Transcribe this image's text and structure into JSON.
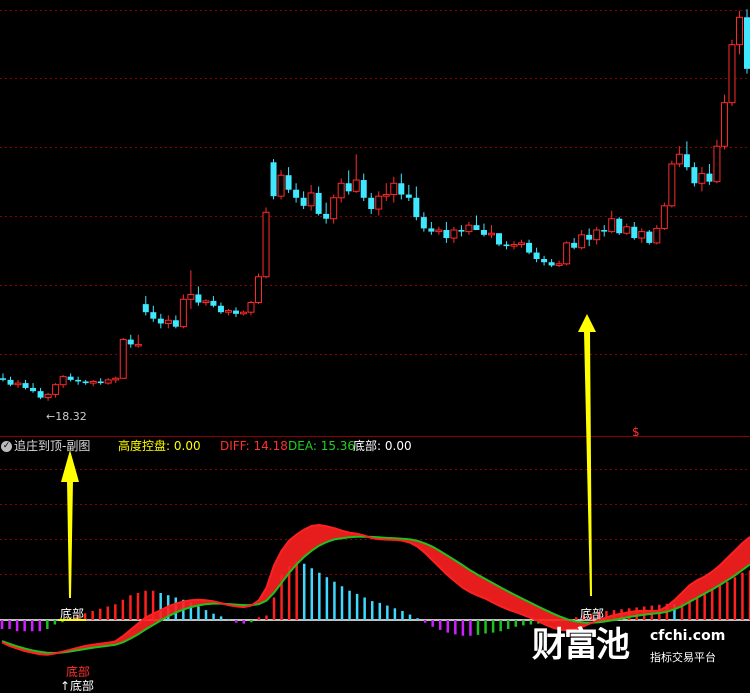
{
  "header": {
    "indicator_name": "追庄到顶-副图",
    "items": [
      {
        "label": "高度控盘:",
        "value": "0.00",
        "color": "#ffff00"
      },
      {
        "label": "DIFF:",
        "value": "14.18",
        "color": "#ff3030"
      },
      {
        "label": "DEA:",
        "value": "15.36",
        "color": "#20d020"
      },
      {
        "label": "底部:",
        "value": "0.00",
        "color": "#ffffff"
      }
    ]
  },
  "annotations": {
    "low_price_label": "←18.32",
    "signal_mark": "$",
    "bottom_label_1": "底部",
    "bottom_label_2": "底部",
    "bottom_label_3": "↑底部",
    "bottom_label_3_overlay": "底部"
  },
  "watermark": {
    "brand": "财富池",
    "site": "cfchi.com",
    "tagline": "指标交易平台"
  },
  "colors": {
    "up": "#ff2a2a",
    "down": "#40e8ff",
    "grid": "#8b0000",
    "diff": "#ff2020",
    "dea": "#20c020",
    "arrow": "#ffff00",
    "hist_pos_red": "#ff2020",
    "hist_pos_cyan": "#40d8ff",
    "hist_neg_magenta": "#d020ff",
    "hist_neg_green": "#20c020"
  },
  "chart_data": [
    {
      "type": "candlestick",
      "title": "",
      "ylim": [
        16,
        42
      ],
      "grid": true,
      "candles": [
        [
          18.9,
          19.2,
          18.7,
          18.8
        ],
        [
          18.8,
          19.0,
          18.4,
          18.5
        ],
        [
          18.5,
          18.8,
          18.3,
          18.6
        ],
        [
          18.6,
          18.8,
          18.2,
          18.3
        ],
        [
          18.3,
          18.6,
          18.0,
          18.1
        ],
        [
          18.1,
          18.3,
          17.6,
          17.7
        ],
        [
          17.7,
          18.0,
          17.5,
          17.9
        ],
        [
          17.9,
          18.6,
          17.7,
          18.5
        ],
        [
          18.5,
          19.1,
          18.3,
          19.0
        ],
        [
          19.0,
          19.2,
          18.7,
          18.8
        ],
        [
          18.8,
          19.0,
          18.5,
          18.7
        ],
        [
          18.7,
          18.8,
          18.5,
          18.6
        ],
        [
          18.6,
          18.8,
          18.4,
          18.7
        ],
        [
          18.7,
          18.9,
          18.5,
          18.6
        ],
        [
          18.6,
          18.9,
          18.5,
          18.8
        ],
        [
          18.8,
          19.0,
          18.6,
          18.9
        ],
        [
          18.9,
          21.4,
          18.9,
          21.3
        ],
        [
          21.3,
          21.6,
          20.8,
          21.0
        ],
        [
          21.0,
          21.6,
          20.8,
          21.0
        ],
        [
          23.5,
          24.0,
          22.8,
          23.0
        ],
        [
          23.0,
          23.4,
          22.4,
          22.6
        ],
        [
          22.6,
          22.9,
          22.0,
          22.3
        ],
        [
          22.3,
          22.8,
          22.0,
          22.5
        ],
        [
          22.5,
          22.8,
          22.0,
          22.1
        ],
        [
          22.1,
          24.1,
          22.0,
          23.8
        ],
        [
          23.8,
          25.6,
          23.2,
          24.1
        ],
        [
          24.1,
          24.6,
          23.4,
          23.6
        ],
        [
          23.6,
          23.8,
          23.4,
          23.7
        ],
        [
          23.7,
          24.0,
          23.3,
          23.4
        ],
        [
          23.4,
          23.6,
          22.9,
          23.0
        ],
        [
          23.0,
          23.2,
          22.8,
          23.1
        ],
        [
          23.1,
          23.3,
          22.7,
          22.9
        ],
        [
          22.9,
          23.1,
          22.8,
          23.0
        ],
        [
          23.0,
          23.7,
          22.8,
          23.6
        ],
        [
          23.6,
          25.4,
          23.5,
          25.2
        ],
        [
          25.2,
          29.5,
          25.1,
          29.2
        ],
        [
          32.3,
          32.5,
          30.0,
          30.2
        ],
        [
          30.2,
          31.8,
          30.0,
          31.5
        ],
        [
          31.5,
          32.0,
          30.4,
          30.6
        ],
        [
          30.6,
          31.0,
          29.8,
          30.1
        ],
        [
          30.1,
          30.5,
          29.4,
          29.6
        ],
        [
          29.6,
          30.9,
          29.3,
          30.4
        ],
        [
          30.4,
          30.8,
          29.0,
          29.1
        ],
        [
          29.1,
          29.8,
          28.5,
          28.8
        ],
        [
          28.8,
          30.3,
          28.5,
          30.1
        ],
        [
          30.1,
          31.3,
          29.8,
          31.0
        ],
        [
          31.0,
          31.8,
          30.3,
          30.5
        ],
        [
          30.5,
          32.8,
          30.4,
          31.2
        ],
        [
          31.2,
          31.6,
          29.9,
          30.1
        ],
        [
          30.1,
          30.4,
          29.1,
          29.4
        ],
        [
          29.4,
          30.5,
          29.0,
          30.2
        ],
        [
          30.2,
          31.0,
          29.9,
          30.3
        ],
        [
          30.3,
          31.4,
          29.8,
          31.0
        ],
        [
          31.0,
          31.6,
          30.0,
          30.3
        ],
        [
          30.3,
          30.9,
          29.9,
          30.1
        ],
        [
          30.1,
          30.8,
          28.7,
          28.9
        ],
        [
          28.9,
          29.2,
          28.0,
          28.2
        ],
        [
          28.2,
          28.6,
          27.8,
          28.0
        ],
        [
          28.0,
          28.3,
          27.8,
          28.1
        ],
        [
          28.1,
          28.6,
          27.3,
          27.6
        ],
        [
          27.6,
          28.3,
          27.3,
          28.1
        ],
        [
          28.1,
          28.4,
          27.7,
          28.0
        ],
        [
          28.0,
          28.6,
          27.8,
          28.4
        ],
        [
          28.4,
          29.0,
          28.2,
          28.1
        ],
        [
          28.1,
          28.5,
          27.7,
          27.8
        ],
        [
          27.8,
          28.4,
          27.6,
          27.9
        ],
        [
          27.9,
          27.9,
          27.1,
          27.2
        ],
        [
          27.2,
          27.4,
          26.9,
          27.1
        ],
        [
          27.1,
          27.4,
          26.9,
          27.2
        ],
        [
          27.2,
          27.5,
          27.0,
          27.3
        ],
        [
          27.3,
          27.5,
          26.6,
          26.7
        ],
        [
          26.7,
          27.0,
          26.1,
          26.3
        ],
        [
          26.3,
          26.5,
          25.9,
          26.1
        ],
        [
          26.1,
          26.3,
          25.8,
          25.9
        ],
        [
          25.9,
          26.2,
          25.8,
          26.0
        ],
        [
          26.0,
          27.4,
          25.9,
          27.3
        ],
        [
          27.3,
          27.6,
          26.9,
          27.0
        ],
        [
          27.0,
          28.1,
          26.9,
          27.8
        ],
        [
          27.8,
          28.2,
          27.1,
          27.5
        ],
        [
          27.5,
          28.3,
          27.2,
          28.1
        ],
        [
          28.1,
          28.4,
          27.7,
          28.0
        ],
        [
          28.0,
          29.3,
          27.9,
          28.8
        ],
        [
          28.8,
          28.9,
          27.8,
          27.9
        ],
        [
          27.9,
          28.5,
          27.8,
          28.3
        ],
        [
          28.3,
          28.6,
          27.5,
          27.6
        ],
        [
          27.6,
          28.2,
          27.3,
          28.0
        ],
        [
          28.0,
          28.1,
          27.2,
          27.3
        ],
        [
          27.3,
          28.4,
          27.2,
          28.2
        ],
        [
          28.2,
          29.8,
          28.1,
          29.6
        ],
        [
          29.6,
          32.4,
          29.5,
          32.2
        ],
        [
          32.2,
          33.3,
          32.0,
          32.8
        ],
        [
          32.8,
          33.6,
          31.8,
          32.0
        ],
        [
          32.0,
          32.3,
          30.8,
          31.0
        ],
        [
          31.0,
          32.0,
          30.5,
          31.6
        ],
        [
          31.6,
          32.2,
          30.9,
          31.1
        ],
        [
          31.1,
          33.7,
          31.0,
          33.3
        ],
        [
          33.3,
          36.5,
          33.1,
          36.0
        ],
        [
          36.0,
          39.9,
          35.8,
          39.6
        ],
        [
          39.6,
          41.7,
          39.0,
          41.3
        ],
        [
          41.3,
          41.8,
          37.8,
          38.1
        ]
      ],
      "annotation": {
        "label": "←18.32",
        "value": 18.32
      }
    },
    {
      "type": "line",
      "title": "追庄到顶-副图",
      "ylim": [
        -15,
        50
      ],
      "series": [
        {
          "name": "DIFF",
          "values": [
            -9.0,
            -10.5,
            -11.5,
            -12.5,
            -13.2,
            -13.8,
            -14.0,
            -13.5,
            -12.8,
            -12.0,
            -11.2,
            -10.5,
            -10.0,
            -9.6,
            -9.2,
            -8.6,
            -6.5,
            -4.0,
            -1.5,
            1.0,
            2.5,
            4.0,
            5.5,
            6.6,
            7.4,
            8.0,
            8.2,
            8.0,
            7.5,
            6.8,
            6.0,
            5.5,
            5.2,
            5.8,
            8.0,
            13.0,
            22.0,
            28.0,
            32.0,
            34.5,
            36.5,
            38.0,
            38.3,
            37.8,
            37.0,
            36.0,
            35.2,
            34.8,
            34.0,
            33.0,
            32.6,
            32.4,
            32.3,
            32.0,
            31.2,
            29.5,
            27.0,
            24.0,
            21.0,
            18.0,
            15.5,
            13.0,
            11.2,
            9.8,
            8.6,
            7.0,
            5.5,
            4.2,
            3.2,
            2.0,
            0.8,
            -0.5,
            -2.0,
            -3.2,
            -4.0,
            -4.2,
            -3.5,
            -2.5,
            -1.2,
            0.0,
            1.0,
            2.0,
            2.6,
            3.2,
            3.6,
            3.8,
            3.6,
            3.8,
            5.5,
            8.0,
            11.0,
            14.0,
            16.0,
            17.5,
            19.5,
            22.0,
            25.0,
            28.0,
            31.0,
            33.5
          ]
        },
        {
          "name": "DEA",
          "values": [
            -8.5,
            -9.6,
            -10.6,
            -11.5,
            -12.2,
            -12.8,
            -13.2,
            -13.3,
            -13.1,
            -12.7,
            -12.2,
            -11.7,
            -11.2,
            -10.8,
            -10.4,
            -10.0,
            -9.0,
            -7.5,
            -5.8,
            -3.8,
            -2.0,
            -0.2,
            1.5,
            3.0,
            4.2,
            5.2,
            5.9,
            6.4,
            6.6,
            6.6,
            6.4,
            6.2,
            6.0,
            6.0,
            6.4,
            7.8,
            11.0,
            15.0,
            19.0,
            22.5,
            25.5,
            28.0,
            30.0,
            31.5,
            32.5,
            33.0,
            33.4,
            33.6,
            33.6,
            33.5,
            33.3,
            33.1,
            33.0,
            32.8,
            32.5,
            31.9,
            30.9,
            29.5,
            27.8,
            25.9,
            24.0,
            22.0,
            20.0,
            18.2,
            16.5,
            14.8,
            13.1,
            11.5,
            9.9,
            8.4,
            6.9,
            5.4,
            3.9,
            2.5,
            1.2,
            0.1,
            -0.6,
            -1.0,
            -1.1,
            -0.9,
            -0.5,
            0.0,
            0.6,
            1.2,
            1.7,
            2.1,
            2.5,
            2.8,
            3.3,
            4.3,
            5.6,
            7.3,
            9.0,
            10.7,
            12.3,
            14.1,
            16.0,
            18.0,
            20.2,
            22.4
          ]
        }
      ],
      "histogram": [
        -2,
        -2,
        -2.5,
        -2.5,
        -2.5,
        -2.5,
        -2,
        -1,
        -0.5,
        0.5,
        1,
        1.5,
        2,
        2.5,
        3,
        3.5,
        4.5,
        5.5,
        6,
        6.5,
        6.5,
        6,
        5.5,
        5,
        4.5,
        3.8,
        3,
        2.2,
        1.4,
        0.8,
        0.2,
        -0.6,
        -0.8,
        -0.5,
        0.6,
        1,
        5,
        10,
        12,
        13,
        12.5,
        11.5,
        10.5,
        9.5,
        8.5,
        7.5,
        6.5,
        5.8,
        5,
        4.2,
        3.8,
        3.2,
        2.6,
        2,
        1.2,
        0.4,
        -0.6,
        -1.5,
        -2.2,
        -2.8,
        -3.2,
        -3.5,
        -3.5,
        -3.3,
        -3.0,
        -2.8,
        -2.5,
        -2.0,
        -1.5,
        -1.2,
        -1.0,
        -0.8,
        -0.6,
        -0.5,
        -0.3,
        0.2,
        0.6,
        1.0,
        1.4,
        1.8,
        2.0,
        2.2,
        2.4,
        2.6,
        2.8,
        3,
        3.2,
        3.4,
        3.6,
        3.5,
        3.8,
        4.5,
        5.0,
        5.8,
        6.8,
        7.8,
        8.5,
        9.5,
        10.5,
        11.0
      ],
      "annotations": [
        {
          "label": "底部",
          "index": 5
        },
        {
          "label": "底部",
          "index": 72
        },
        {
          "label": "↑底部",
          "index": 6
        }
      ]
    }
  ]
}
